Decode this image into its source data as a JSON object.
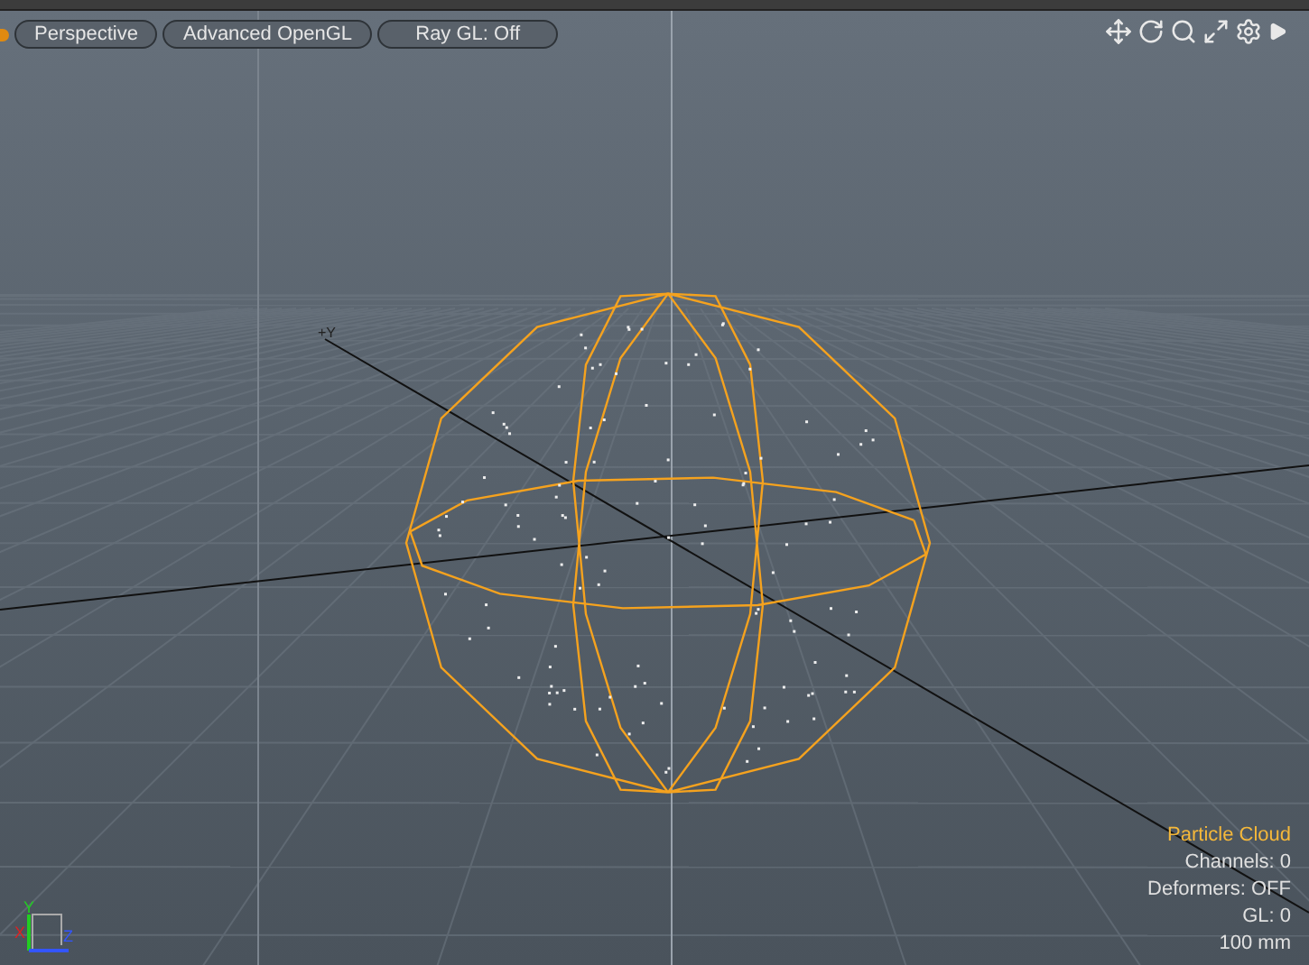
{
  "toolbar": {
    "buttons": [
      {
        "label": "Perspective"
      },
      {
        "label": "Advanced OpenGL"
      },
      {
        "label": "Ray GL: Off"
      }
    ]
  },
  "viewport": {
    "axis_label": "+Y",
    "info": {
      "title": "Particle Cloud",
      "lines": [
        "Channels: 0",
        "Deformers: OFF",
        "GL: 0",
        "100 mm"
      ]
    },
    "gizmo": [
      {
        "label": "Y",
        "color": "#22cc22"
      },
      {
        "label": "X",
        "color": "#dd2222"
      },
      {
        "label": "Z",
        "color": "#3355ff"
      }
    ]
  }
}
